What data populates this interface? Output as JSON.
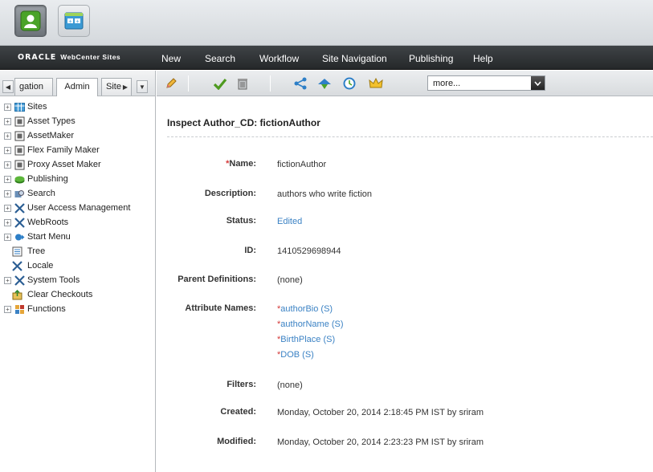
{
  "appbar": {
    "apps": [
      {
        "icon": "contributor-app-icon",
        "active": true
      },
      {
        "icon": "admin-app-icon",
        "active": false
      }
    ]
  },
  "navbar": {
    "brand_oracle": "ORACLE",
    "brand_product": "WebCenter Sites",
    "items": [
      "New",
      "Search",
      "Workflow",
      "Site Navigation",
      "Publishing",
      "Help"
    ]
  },
  "left_panel": {
    "tabs": [
      "gation",
      "Admin",
      "Site"
    ],
    "active_tab": "Admin",
    "tree": [
      {
        "label": "Sites",
        "icon": "sites-icon",
        "expandable": true
      },
      {
        "label": "Asset Types",
        "icon": "asset-type-icon",
        "expandable": true
      },
      {
        "label": "AssetMaker",
        "icon": "asset-maker-icon",
        "expandable": true
      },
      {
        "label": "Flex Family Maker",
        "icon": "flex-family-icon",
        "expandable": true
      },
      {
        "label": "Proxy Asset Maker",
        "icon": "proxy-asset-icon",
        "expandable": true
      },
      {
        "label": "Publishing",
        "icon": "publishing-icon",
        "expandable": true
      },
      {
        "label": "Search",
        "icon": "search-icon",
        "expandable": true
      },
      {
        "label": "User Access Management",
        "icon": "tools-icon",
        "expandable": true
      },
      {
        "label": "WebRoots",
        "icon": "tools-icon",
        "expandable": true
      },
      {
        "label": "Start Menu",
        "icon": "start-menu-icon",
        "expandable": true
      },
      {
        "label": "Tree",
        "icon": "tree-icon",
        "expandable": false
      },
      {
        "label": "Locale",
        "icon": "tools-icon",
        "expandable": false
      },
      {
        "label": "System Tools",
        "icon": "tools-icon",
        "expandable": true
      },
      {
        "label": "Clear Checkouts",
        "icon": "clear-checkouts-icon",
        "expandable": false
      },
      {
        "label": "Functions",
        "icon": "functions-icon",
        "expandable": true
      }
    ]
  },
  "toolbar": {
    "buttons": [
      "edit-icon",
      "approve-icon",
      "delete-icon",
      "share-icon",
      "bookmark-icon",
      "schedule-icon",
      "crown-icon"
    ],
    "more_select_value": "more..."
  },
  "inspect": {
    "title": "Inspect Author_CD: fictionAuthor",
    "fields": {
      "name_label": "Name:",
      "name_value": "fictionAuthor",
      "description_label": "Description:",
      "description_value": "authors who write fiction",
      "status_label": "Status:",
      "status_value": "Edited",
      "id_label": "ID:",
      "id_value": "1410529698944",
      "parent_label": "Parent Definitions:",
      "parent_value": "(none)",
      "attributes_label": "Attribute Names:",
      "attributes": [
        "authorBio (S)",
        "authorName (S)",
        "BirthPlace (S)",
        "DOB (S)"
      ],
      "filters_label": "Filters:",
      "filters_value": "(none)",
      "created_label": "Created:",
      "created_value": "Monday, October 20, 2014 2:18:45 PM IST by sriram",
      "modified_label": "Modified:",
      "modified_value": "Monday, October 20, 2014 2:23:23 PM IST by sriram"
    }
  },
  "colors": {
    "nav_bg": "#2d3134",
    "link": "#3b82c4",
    "required": "#d43a3a"
  }
}
